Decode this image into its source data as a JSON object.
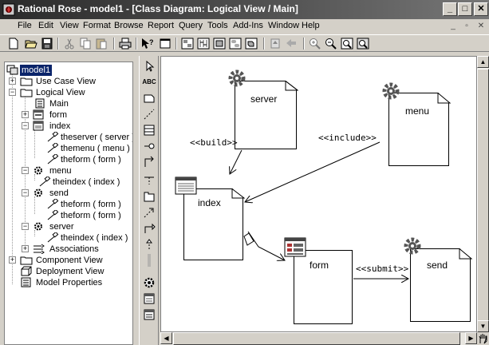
{
  "window": {
    "title": "Rational Rose - model1 - [Class Diagram: Logical View / Main]",
    "minimize": "_",
    "maximize": "□",
    "close": "✕"
  },
  "menubar": {
    "items": [
      "File",
      "Edit",
      "View",
      "Format",
      "Browse",
      "Report",
      "Query",
      "Tools",
      "Add-Ins",
      "Window",
      "Help"
    ]
  },
  "tree": {
    "root": "model1",
    "items": [
      {
        "label": "Use Case View"
      },
      {
        "label": "Logical View"
      },
      {
        "label": "Main"
      },
      {
        "label": "form"
      },
      {
        "label": "index"
      },
      {
        "label": "theserver ( server )"
      },
      {
        "label": "themenu ( menu )"
      },
      {
        "label": "theform ( form )"
      },
      {
        "label": "menu"
      },
      {
        "label": "theindex ( index )"
      },
      {
        "label": "send"
      },
      {
        "label": "theform ( form )"
      },
      {
        "label": "theform ( form )"
      },
      {
        "label": "server"
      },
      {
        "label": "theindex ( index )"
      },
      {
        "label": "Associations"
      },
      {
        "label": "Component View"
      },
      {
        "label": "Deployment View"
      },
      {
        "label": "Model Properties"
      }
    ]
  },
  "palette": {
    "text_tool": "ABC"
  },
  "diagram": {
    "classes": {
      "server": "server",
      "menu": "menu",
      "index": "index",
      "form": "form",
      "send": "send"
    },
    "stereotypes": {
      "build": "<<build>>",
      "include": "<<include>>",
      "submit": "<<submit>>"
    }
  }
}
